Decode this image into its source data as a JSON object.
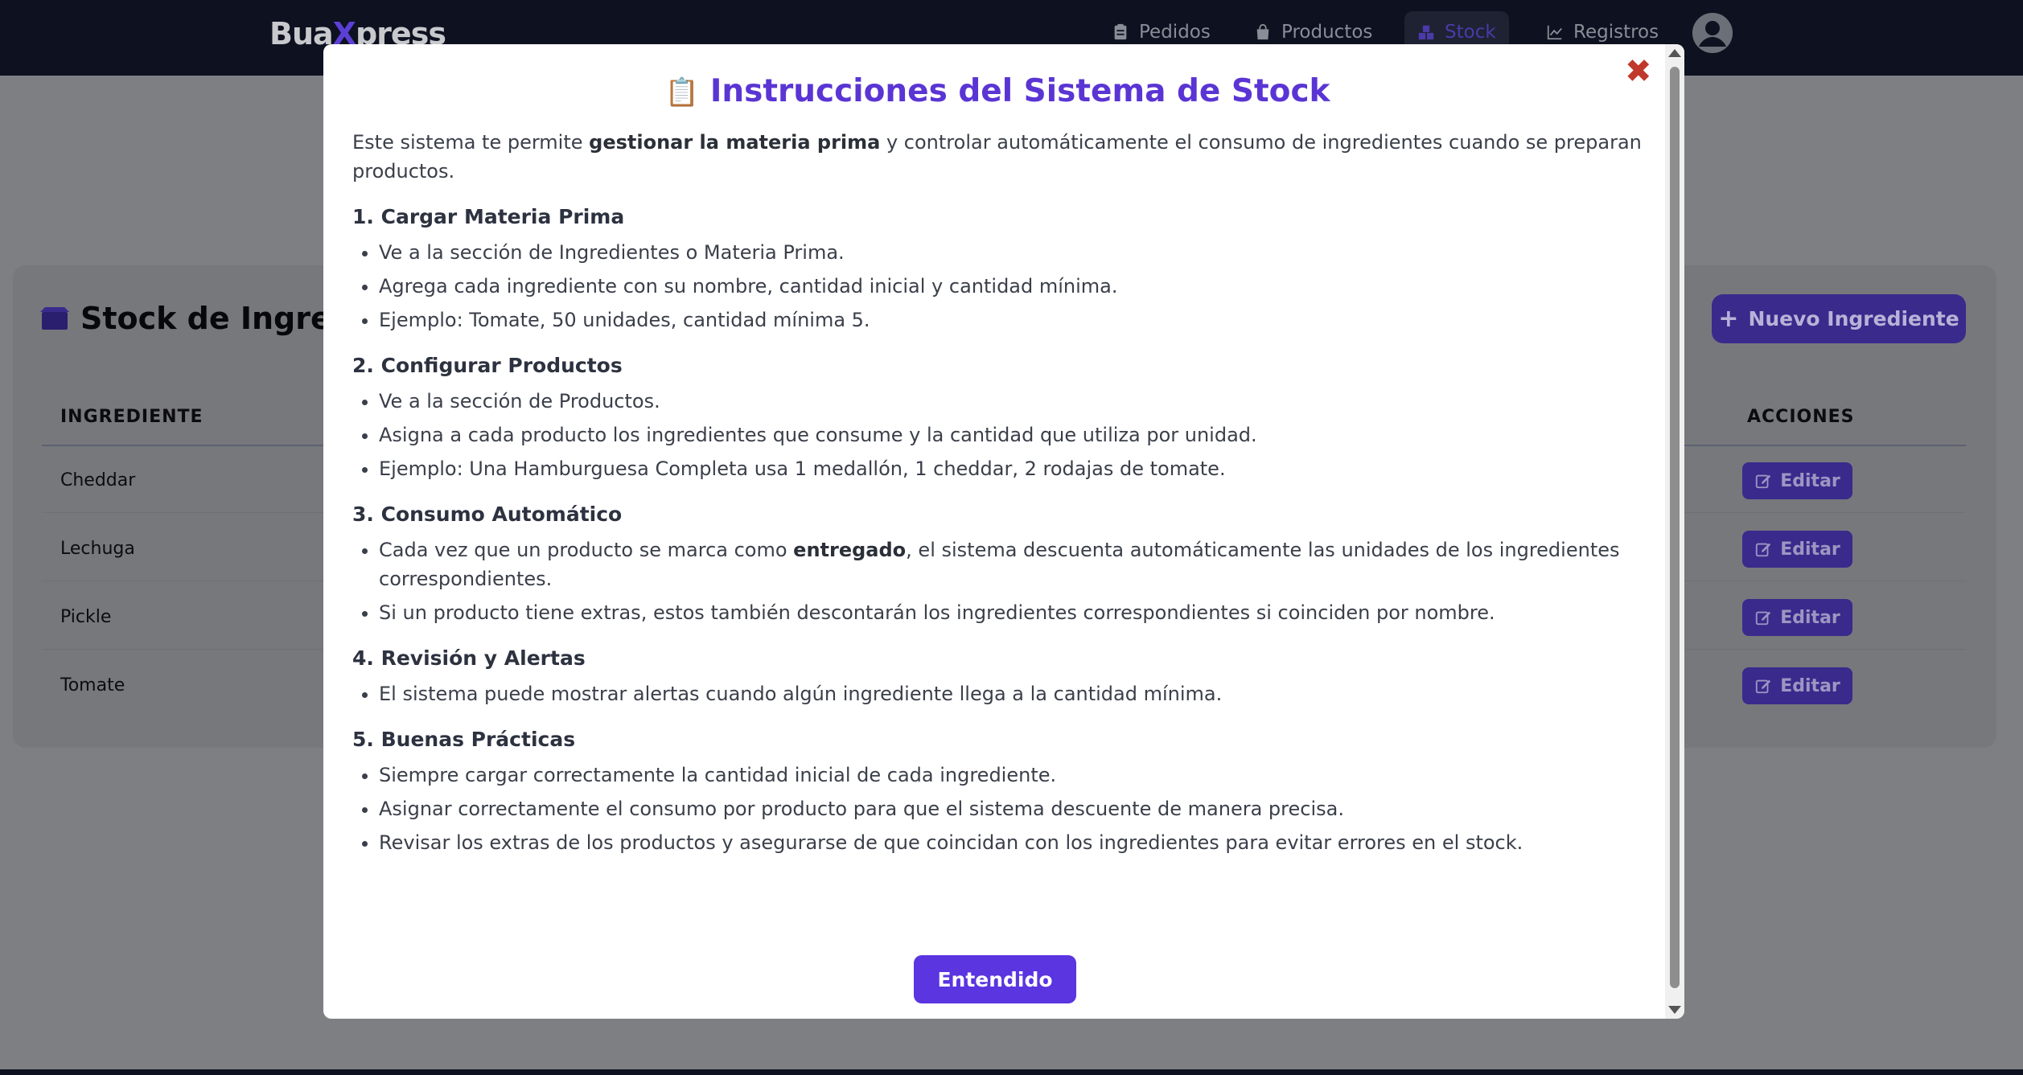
{
  "nav": {
    "logo_prefix": "Bua",
    "logo_x": "X",
    "logo_suffix": "press",
    "items": [
      {
        "label": "Pedidos",
        "icon": "clipboard-icon"
      },
      {
        "label": "Productos",
        "icon": "shopping-bag-icon"
      },
      {
        "label": "Stock",
        "icon": "boxes-icon",
        "active": true
      },
      {
        "label": "Registros",
        "icon": "chart-line-icon"
      }
    ],
    "avatar_icon": "user-circle-icon"
  },
  "stock": {
    "title": "Stock de Ingred",
    "new_button": "Nuevo Ingrediente",
    "col_ingrediente": "INGREDIENTE",
    "col_acciones": "ACCIONES",
    "rows": [
      {
        "name": "Cheddar",
        "action": "Editar"
      },
      {
        "name": "Lechuga",
        "action": "Editar"
      },
      {
        "name": "Pickle",
        "action": "Editar"
      },
      {
        "name": "Tomate",
        "action": "Editar"
      }
    ]
  },
  "modal": {
    "close": "✖",
    "title_icon": "📋",
    "title": "Instrucciones del Sistema de Stock",
    "intro_a": "Este sistema te permite ",
    "intro_b": "gestionar la materia prima",
    "intro_c": " y controlar automáticamente el consumo de ingredientes cuando se preparan productos.",
    "s1_title": "1. Cargar Materia Prima",
    "s1_items": [
      "Ve a la sección de Ingredientes o Materia Prima.",
      "Agrega cada ingrediente con su nombre, cantidad inicial y cantidad mínima.",
      "Ejemplo: Tomate, 50 unidades, cantidad mínima 5."
    ],
    "s2_title": "2. Configurar Productos",
    "s2_items": [
      "Ve a la sección de Productos.",
      "Asigna a cada producto los ingredientes que consume y la cantidad que utiliza por unidad.",
      "Ejemplo: Una Hamburguesa Completa usa 1 medallón, 1 cheddar, 2 rodajas de tomate."
    ],
    "s3_title": "3. Consumo Automático",
    "s3_item1_a": "Cada vez que un producto se marca como ",
    "s3_item1_b": "entregado",
    "s3_item1_c": ", el sistema descuenta automáticamente las unidades de los ingredientes correspondientes.",
    "s3_item2": "Si un producto tiene extras, estos también descontarán los ingredientes correspondientes si coinciden por nombre.",
    "s4_title": "4. Revisión y Alertas",
    "s4_items": [
      "El sistema puede mostrar alertas cuando algún ingrediente llega a la cantidad mínima."
    ],
    "s5_title": "5. Buenas Prácticas",
    "s5_items": [
      "Siempre cargar correctamente la cantidad inicial de cada ingrediente.",
      "Asignar correctamente el consumo por producto para que el sistema descuente de manera precisa.",
      "Revisar los extras de los productos y asegurarse de que coincidan con los ingredientes para evitar errores en el stock."
    ],
    "ok_button": "Entendido"
  }
}
